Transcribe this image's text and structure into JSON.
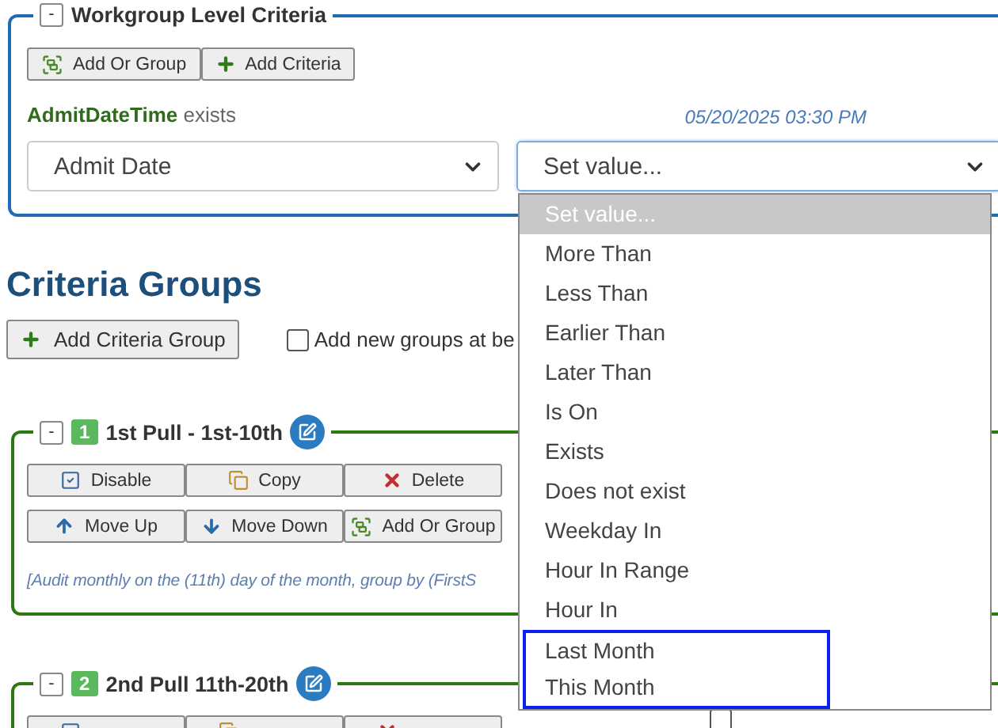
{
  "workgroup_panel": {
    "collapse": "-",
    "title": "Workgroup Level Criteria",
    "buttons": [
      {
        "label": "Add Or Group",
        "kind": "group"
      },
      {
        "label": "Add Criteria",
        "kind": "add"
      }
    ],
    "criterion": {
      "field": "AdmitDateTime",
      "condition": "exists",
      "timestamp": "05/20/2025 03:30 PM"
    },
    "field_select": {
      "value": "Admit Date"
    },
    "operator_select": {
      "value": "Set value...",
      "expanded": true,
      "options": [
        {
          "label": "Set value...",
          "selected": true,
          "highlighted": false
        },
        {
          "label": "More Than",
          "selected": false,
          "highlighted": false
        },
        {
          "label": "Less Than",
          "selected": false,
          "highlighted": false
        },
        {
          "label": "Earlier Than",
          "selected": false,
          "highlighted": false
        },
        {
          "label": "Later Than",
          "selected": false,
          "highlighted": false
        },
        {
          "label": "Is On",
          "selected": false,
          "highlighted": false
        },
        {
          "label": "Exists",
          "selected": false,
          "highlighted": false
        },
        {
          "label": "Does not exist",
          "selected": false,
          "highlighted": false
        },
        {
          "label": "Weekday In",
          "selected": false,
          "highlighted": false
        },
        {
          "label": "Hour In Range",
          "selected": false,
          "highlighted": false
        },
        {
          "label": "Hour In",
          "selected": false,
          "highlighted": false
        },
        {
          "label": "Last Month",
          "selected": false,
          "highlighted": true
        },
        {
          "label": "This Month",
          "selected": false,
          "highlighted": true
        }
      ]
    }
  },
  "criteria_groups": {
    "heading": "Criteria Groups",
    "add_button": {
      "label": "Add Criteria Group",
      "kind": "add"
    },
    "add_at_beginning": {
      "label": "Add new groups at be",
      "checked": false
    },
    "groups": [
      {
        "collapse": "-",
        "number": "1",
        "title": "1st Pull - 1st-10th",
        "button_rows": [
          [
            {
              "label": "Disable",
              "kind": "disable"
            },
            {
              "label": "Copy",
              "kind": "copy"
            },
            {
              "label": "Delete",
              "kind": "delete"
            }
          ],
          [
            {
              "label": "Move Up",
              "kind": "up"
            },
            {
              "label": "Move Down",
              "kind": "down"
            },
            {
              "label": "Add Or Group",
              "kind": "group"
            }
          ]
        ],
        "description": "[Audit monthly on the (11th) day of the month, group by (FirstS"
      },
      {
        "collapse": "-",
        "number": "2",
        "title": "2nd Pull 11th-20th",
        "button_rows": [
          [
            {
              "kind": "disable"
            },
            {
              "kind": "copy"
            },
            {
              "kind": "delete"
            }
          ]
        ],
        "include_workgroup": {
          "checked": false
        }
      }
    ]
  }
}
